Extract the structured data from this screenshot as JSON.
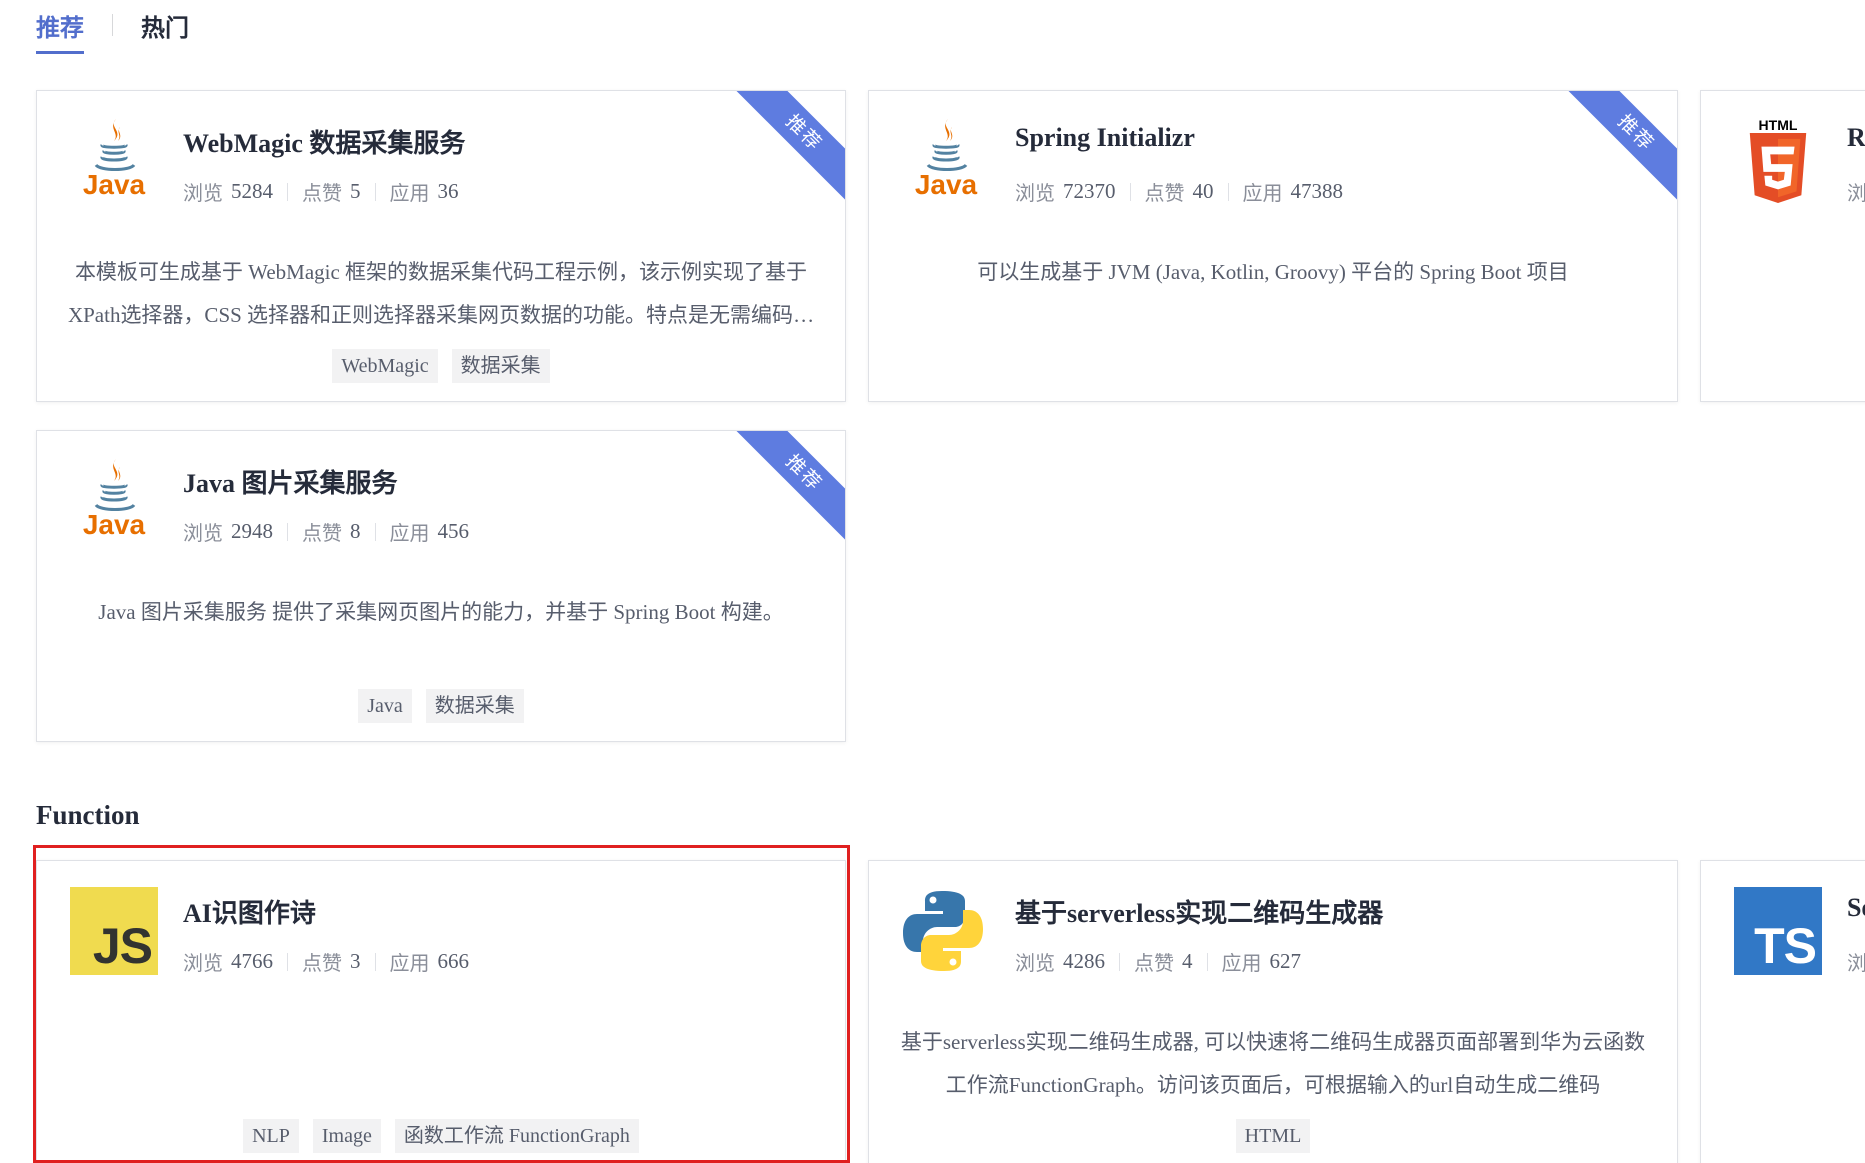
{
  "tabs": [
    {
      "label": "推荐"
    },
    {
      "label": "热门"
    }
  ],
  "ribbon_label": "推荐",
  "stat_labels": {
    "views": "浏览",
    "likes": "点赞",
    "uses": "应用"
  },
  "cards_top": [
    {
      "title": "WebMagic 数据采集服务",
      "logo": "java-icon",
      "views": "5284",
      "likes": "5",
      "uses": "36",
      "description": "本模板可生成基于 WebMagic 框架的数据采集代码工程示例，该示例实现了基于XPath选择器，CSS 选择器和正则选择器采集网页数据的功能。特点是无需编码，即可快速生成数据采集服务。",
      "tags": [
        "WebMagic",
        "数据采集"
      ]
    },
    {
      "title": "Spring Initializr",
      "logo": "java-icon",
      "views": "72370",
      "likes": "40",
      "uses": "47388",
      "description": "可以生成基于 JVM (Java, Kotlin, Groovy) 平台的 Spring Boot 项目",
      "tags": []
    },
    {
      "title": "Re",
      "logo": "html5-icon",
      "views_partial": "浏"
    },
    {
      "title": "Java 图片采集服务",
      "logo": "java-icon",
      "views": "2948",
      "likes": "8",
      "uses": "456",
      "description": "Java 图片采集服务 提供了采集网页图片的能力，并基于 Spring Boot 构建。",
      "tags": [
        "Java",
        "数据采集"
      ]
    }
  ],
  "function_section": {
    "title": "Function",
    "cards": [
      {
        "title": "AI识图作诗",
        "logo": "javascript-icon",
        "logo_text": "JS",
        "views": "4766",
        "likes": "3",
        "uses": "666",
        "description": "",
        "tags": [
          "NLP",
          "Image",
          "函数工作流 FunctionGraph"
        ]
      },
      {
        "title": "基于serverless实现二维码生成器",
        "logo": "python-icon",
        "views": "4286",
        "likes": "4",
        "uses": "627",
        "description": "基于serverless实现二维码生成器, 可以快速将二维码生成器页面部署到华为云函数工作流FunctionGraph。访问该页面后，可根据输入的url自动生成二维码",
        "tags": [
          "HTML"
        ]
      },
      {
        "title": "Se",
        "logo": "typescript-icon",
        "logo_text": "TS",
        "views_partial": "浏"
      }
    ]
  },
  "colors": {
    "accent": "#526ecc",
    "ribbon": "#5e7ce0",
    "highlight": "#e02020"
  }
}
